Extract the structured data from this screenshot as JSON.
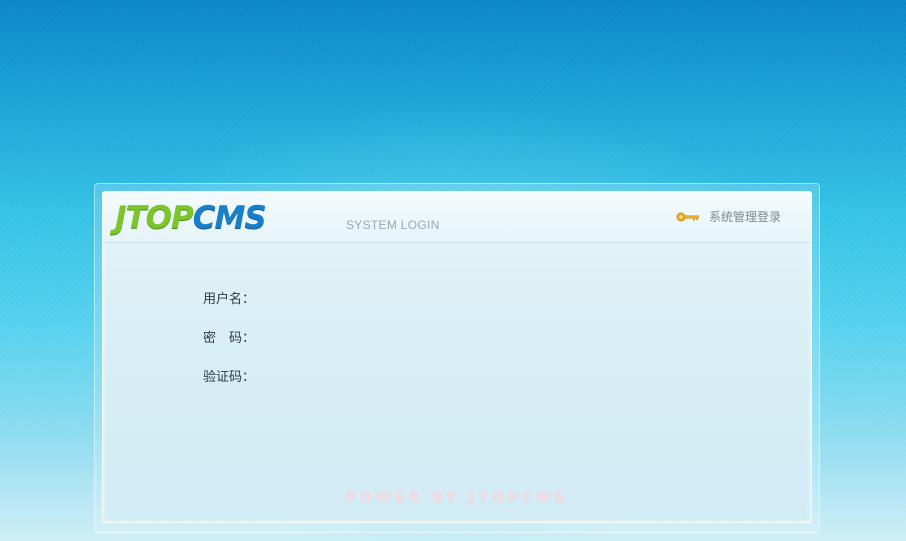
{
  "brand": {
    "logo_part1": "JTOP",
    "logo_part2": "CMS",
    "subtitle": "SYSTEM LOGIN"
  },
  "header": {
    "icon": "key-icon",
    "title": "系统管理登录"
  },
  "form": {
    "username_label": "用户名：",
    "password_label": "密　码：",
    "captcha_label": "验证码："
  },
  "footer": {
    "powered_by": "POWER BY JTOPCMS"
  },
  "colors": {
    "logo_green": "#7cc52a",
    "logo_blue": "#1a7fc9",
    "background_top": "#0a86c7",
    "panel": "#dcf0f6"
  }
}
